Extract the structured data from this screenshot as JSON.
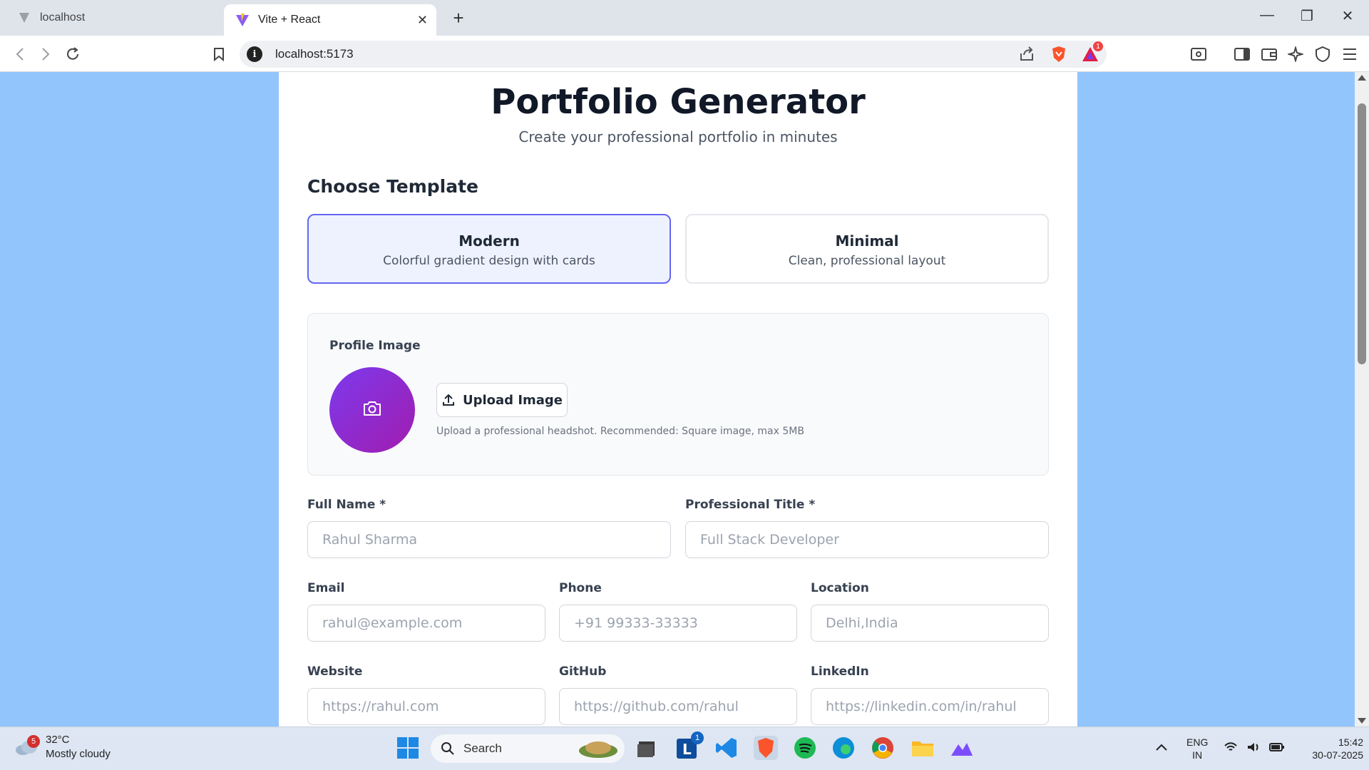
{
  "browser": {
    "tabs": [
      {
        "label": "localhost",
        "active": false
      },
      {
        "label": "Vite + React",
        "active": true
      }
    ],
    "url": "localhost:5173",
    "notification_count": "1"
  },
  "page": {
    "title": "Portfolio Generator",
    "subtitle": "Create your professional portfolio in minutes",
    "template_heading": "Choose Template",
    "templates": [
      {
        "name": "Modern",
        "description": "Colorful gradient design with cards",
        "selected": true
      },
      {
        "name": "Minimal",
        "description": "Clean, professional layout",
        "selected": false
      }
    ],
    "profile": {
      "label": "Profile Image",
      "upload_label": "Upload Image",
      "hint": "Upload a professional headshot. Recommended: Square image, max 5MB"
    },
    "fields": {
      "full_name": {
        "label": "Full Name *",
        "placeholder": "Rahul Sharma"
      },
      "title": {
        "label": "Professional Title *",
        "placeholder": "Full Stack Developer"
      },
      "email": {
        "label": "Email",
        "placeholder": "rahul@example.com"
      },
      "phone": {
        "label": "Phone",
        "placeholder": "+91 99333-33333"
      },
      "location": {
        "label": "Location",
        "placeholder": "Delhi,India"
      },
      "website": {
        "label": "Website",
        "placeholder": "https://rahul.com"
      },
      "github": {
        "label": "GitHub",
        "placeholder": "https://github.com/rahul"
      },
      "linkedin": {
        "label": "LinkedIn",
        "placeholder": "https://linkedin.com/in/rahul"
      }
    }
  },
  "taskbar": {
    "weather_badge": "5",
    "temperature": "32°C",
    "condition": "Mostly cloudy",
    "search_label": "Search",
    "lang_line1": "ENG",
    "lang_line2": "IN",
    "time": "15:42",
    "date": "30-07-2025",
    "outlook_badge": "1"
  },
  "colors": {
    "page_background": "#93c5fd",
    "accent": "#6366f1",
    "avatar_gradient_start": "#7c3aed",
    "avatar_gradient_end": "#a21caf"
  }
}
